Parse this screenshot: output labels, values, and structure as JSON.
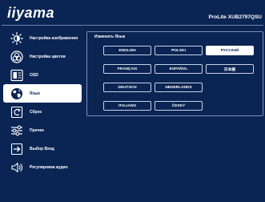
{
  "header": {
    "logo_text": "iiyama",
    "model": "ProLite XUB2797QSU"
  },
  "sidebar": {
    "items": [
      {
        "label": "Настройка изображения",
        "icon": "brightness-icon"
      },
      {
        "label": "Настройка цветов",
        "icon": "color-palette-icon"
      },
      {
        "label": "OSD",
        "icon": "osd-icon"
      },
      {
        "label": "Язык",
        "icon": "globe-icon",
        "active": true
      },
      {
        "label": "Сброс",
        "icon": "reset-icon"
      },
      {
        "label": "Прочее",
        "icon": "sliders-icon"
      },
      {
        "label": "Выбор Вход",
        "icon": "input-select-icon"
      },
      {
        "label": "Регулировка аудио",
        "icon": "speaker-icon"
      }
    ]
  },
  "panel": {
    "title": "Изменить Язык",
    "languages": [
      {
        "label": "ENGLISH"
      },
      {
        "label": "POLSKI"
      },
      {
        "label": "РУССКИЙ",
        "selected": true
      },
      {
        "label": "FRANÇAIS"
      },
      {
        "label": "ESPAÑOL"
      },
      {
        "label": "日本語"
      },
      {
        "label": "DEUTSCH"
      },
      {
        "label": "NEDERLANDS"
      },
      {
        "label": "ITALIANO"
      },
      {
        "label": "ČESKÝ"
      }
    ]
  },
  "colors": {
    "background": "#0a2453",
    "active_item": "#ffffff",
    "border": "#7d93b8"
  }
}
